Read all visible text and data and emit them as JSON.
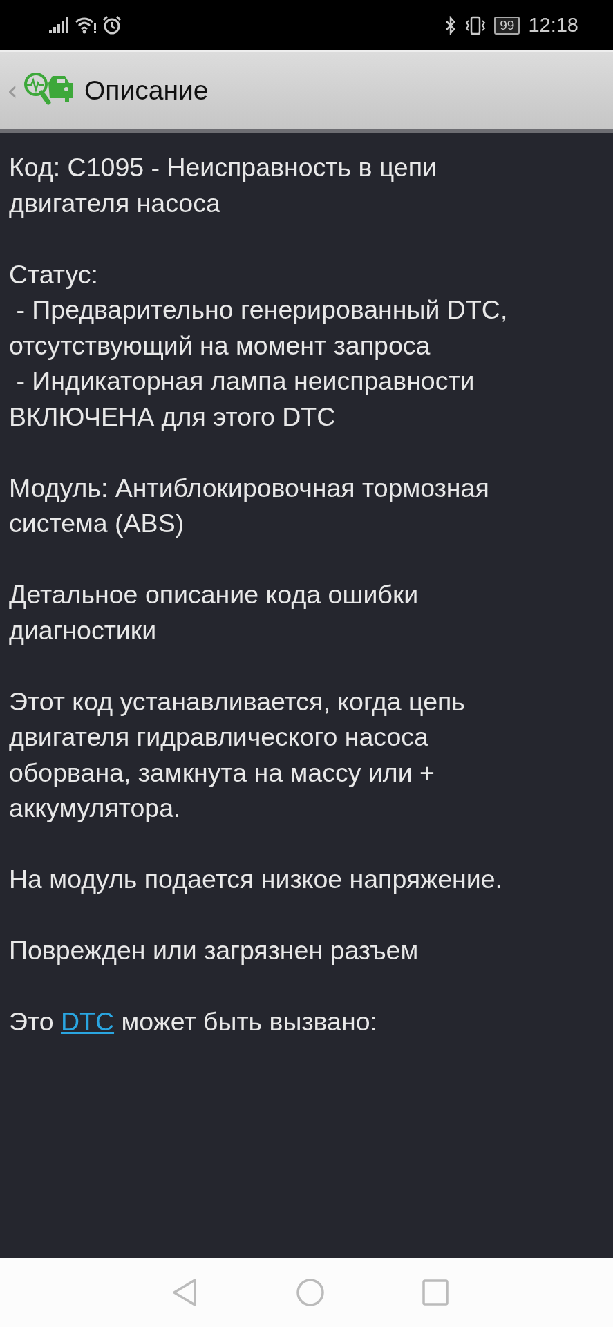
{
  "status_bar": {
    "battery": "99",
    "time": "12:18"
  },
  "header": {
    "back": "‹",
    "title": "Описание"
  },
  "paragraphs": [
    {
      "lines": [
        "Код: C1095 - Неисправность в цепи",
        "двигателя насоса"
      ]
    },
    {
      "lines": [
        "Статус:",
        " - Предварительно генерированный DTC,",
        "отсутствующий на момент запроса",
        " - Индикаторная лампа неисправности",
        "ВКЛЮЧЕНА для этого DTC"
      ]
    },
    {
      "lines": [
        "Модуль: Антиблокировочная тормозная",
        "система (ABS)"
      ]
    },
    {
      "lines": [
        "Детальное описание кода ошибки",
        "диагностики"
      ]
    },
    {
      "lines": [
        "Этот код устанавливается, когда цепь",
        "двигателя гидравлического насоса",
        "оборвана, замкнута на массу или +",
        "аккумулятора."
      ]
    },
    {
      "lines": [
        "На модуль подается низкое напряжение."
      ]
    },
    {
      "lines": [
        "Поврежден или загрязнен разъем"
      ]
    },
    {
      "parts": [
        {
          "kind": "text",
          "text": "Это "
        },
        {
          "kind": "link",
          "text": "DTC"
        },
        {
          "kind": "text",
          "text": " может быть вызвано:"
        }
      ]
    }
  ]
}
